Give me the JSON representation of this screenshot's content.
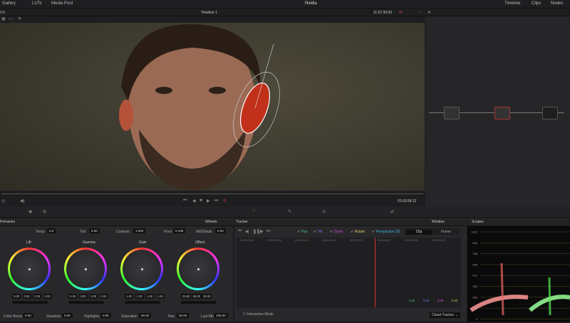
{
  "topbar": {
    "items": [
      "Gallery",
      "LUTs",
      "Media Pool"
    ],
    "project": "Nvidia",
    "right": [
      "Timeline",
      "Clips",
      "Nodes"
    ]
  },
  "viewer": {
    "zoom": "0%",
    "timeline": "Timeline 1",
    "timecode_top": "11:57:30:03",
    "timecode": "01:03:58:12"
  },
  "primaries": {
    "title": "Primaries",
    "mode": "Wheels",
    "adjust": [
      {
        "label": "Temp",
        "value": "0.0"
      },
      {
        "label": "Tint",
        "value": "0.00"
      },
      {
        "label": "Contrast",
        "value": "1.000"
      },
      {
        "label": "Pivot",
        "value": "0.435"
      },
      {
        "label": "Mid/Detail",
        "value": "0.00"
      }
    ],
    "wheels": [
      {
        "label": "Lift",
        "values": [
          "0.00",
          "0.00",
          "0.00",
          "0.00"
        ]
      },
      {
        "label": "Gamma",
        "values": [
          "0.00",
          "0.00",
          "0.00",
          "0.00"
        ]
      },
      {
        "label": "Gain",
        "values": [
          "1.00",
          "1.00",
          "1.00",
          "1.00"
        ]
      },
      {
        "label": "Offset",
        "values": [
          "25.00",
          "25.00",
          "25.00"
        ]
      }
    ],
    "bottom": [
      {
        "label": "Color Boost",
        "value": "0.00"
      },
      {
        "label": "Shadows",
        "value": "0.00"
      },
      {
        "label": "Highlights",
        "value": "0.00"
      },
      {
        "label": "Saturation",
        "value": "50.00"
      },
      {
        "label": "Hue",
        "value": "50.00"
      },
      {
        "label": "Lum Mix",
        "value": "100.00"
      }
    ]
  },
  "tracker": {
    "title": "Tracker",
    "mode": "Window",
    "checks": [
      {
        "label": "Pan",
        "color": "#3fbf7f"
      },
      {
        "label": "Tilt",
        "color": "#6a7bff"
      },
      {
        "label": "Zoom",
        "color": "#d04fd0"
      },
      {
        "label": "Rotate",
        "color": "#d8c85a"
      },
      {
        "label": "Perspective 3D",
        "color": "#3fb7d0"
      }
    ],
    "toggle": [
      "Clip",
      "Frame"
    ],
    "ruler": [
      "00:00:21:19",
      "00:00:23:04",
      "00:00:24:13",
      "00:00:25:22",
      "00:00:27:07",
      "00:00:28:17",
      "00:00:30:02",
      "00:00:31:11"
    ],
    "values": [
      "0.00",
      "0.00",
      "0.00",
      "0.00"
    ],
    "interactive": "Interactive Mode",
    "cloud": "Cloud Tracker"
  },
  "scopes": {
    "title": "Scopes",
    "ticks": [
      "1023",
      "896",
      "768",
      "640",
      "512",
      "384",
      "256",
      "128",
      "0"
    ]
  }
}
